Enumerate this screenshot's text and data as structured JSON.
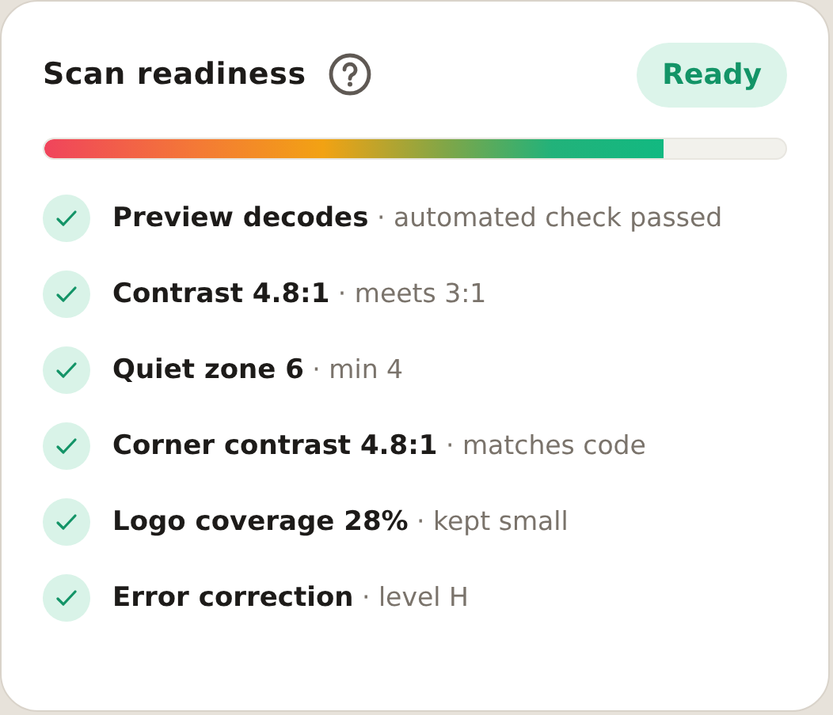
{
  "title": "Scan readiness",
  "status": {
    "label": "Ready"
  },
  "readiness": {
    "level": 0.835
  },
  "checks": [
    {
      "text": "**Preview decodes** · automated check passed",
      "checked": true
    },
    {
      "text": "**Contrast 4.8:1** · meets 3:1",
      "checked": true
    },
    {
      "text": "**Quiet zone 6** · min 4",
      "checked": true
    },
    {
      "text": "**Corner contrast 4.8:1** · matches code",
      "checked": true
    },
    {
      "text": "**Logo coverage 28%** · kept small",
      "checked": true
    },
    {
      "text": "**Error correction** · level H",
      "checked": true
    }
  ]
}
